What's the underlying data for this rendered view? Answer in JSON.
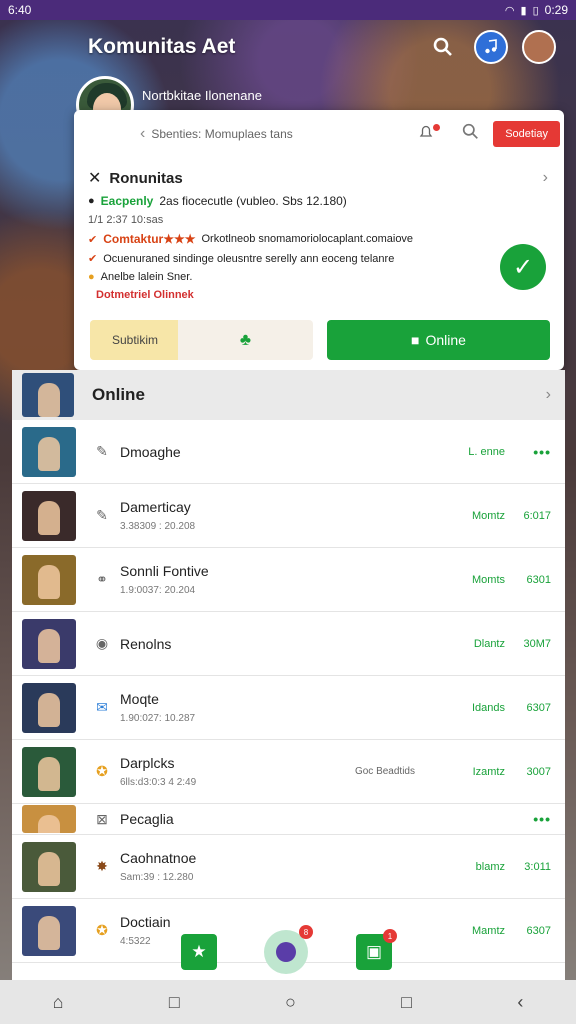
{
  "status_bar": {
    "time": "6:40",
    "right_time": "0:29"
  },
  "header": {
    "title": "Komunitas Aet"
  },
  "profile": {
    "name": "Nortbkitae Ilonenane"
  },
  "card": {
    "search_text": "Sbenties: Momuplaes tans",
    "top_button": "Sodetiay",
    "community_title": "Ronunitas",
    "line1_green": "Eacpenly",
    "line1_rest": "2as fiocecutle (vubleo. Sbs 12.180)",
    "line2": "1/1 2:37 10:sas",
    "line3_orange": "Comtaktur★★★",
    "line3_rest": "Orkotlneob snomamoriolocaplant.comaiove",
    "line4": "Ocuenuraned sindinge oleusntre serelly ann eoceng telanre",
    "line5": "Anelbe lalein Sner.",
    "red_link": "Dotmetriel Olinnek",
    "button_left": "Subtikim",
    "button_online": "Online"
  },
  "colors": {
    "accent_green": "#19a23a",
    "accent_red": "#e53935",
    "status_purple": "#4b2b7a"
  },
  "list": {
    "header": "Online",
    "rows": [
      {
        "name": "Dmoaghe",
        "sub": "",
        "extra": "",
        "status": "L. enne",
        "time": "•••"
      },
      {
        "name": "Damerticay",
        "sub": "3.38309 : 20.208",
        "extra": "",
        "status": "Momtz",
        "time": "6:017"
      },
      {
        "name": "Sonnli Fontive",
        "sub": "1.9:0037: 20.204",
        "extra": "",
        "status": "Momts",
        "time": "6301"
      },
      {
        "name": "Renolns",
        "sub": "",
        "extra": "",
        "status": "Dlantz",
        "time": "30M7"
      },
      {
        "name": "Moqte",
        "sub": "1.90:027: 10.287",
        "extra": "",
        "status": "Idands",
        "time": "6307"
      },
      {
        "name": "Darplcks",
        "sub": "6lls:d3:0:3 4 2:49",
        "extra": "Goc Beadtids",
        "status": "Izamtz",
        "time": "3007"
      },
      {
        "name": "Pecaglia",
        "sub": "",
        "extra": "",
        "status": "",
        "time": "•••"
      },
      {
        "name": "Caohnatnoe",
        "sub": "Sam:39 : 12.280",
        "extra": "",
        "status": "blamz",
        "time": "3:011"
      },
      {
        "name": "Doctiain",
        "sub": "4:5322",
        "extra": "",
        "status": "Mamtz",
        "time": "6307"
      }
    ]
  },
  "dock": {
    "badge_center": "8",
    "badge_right": "1"
  }
}
